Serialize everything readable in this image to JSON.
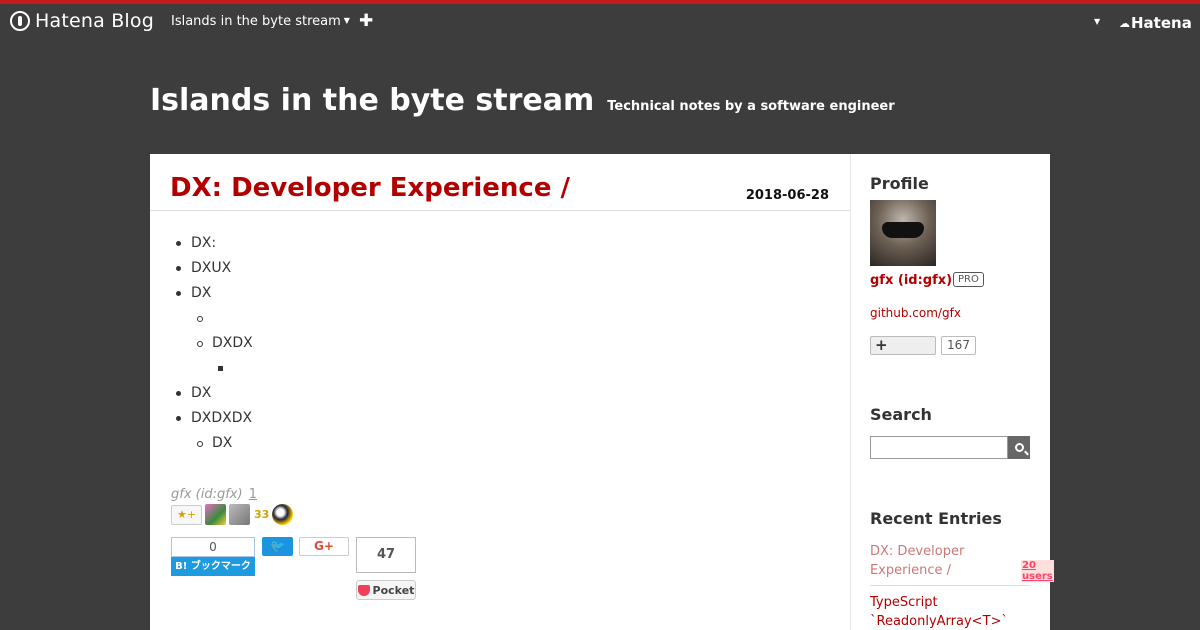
{
  "globalbar": {
    "logo_text": "Hatena Blog",
    "blog_switch": "Islands in the byte stream",
    "plus": "✚",
    "right_caret": "▼",
    "hatena": "Hatena"
  },
  "header": {
    "title": "Islands in the byte stream",
    "description": "Technical notes by a software engineer"
  },
  "entry": {
    "title": "DX: Developer Experience /",
    "date": "2018-06-28",
    "list": [
      {
        "level": 1,
        "text": "DX:"
      },
      {
        "level": 1,
        "text": "DXUX"
      },
      {
        "level": 1,
        "text": "DX"
      },
      {
        "level": 2,
        "text": ""
      },
      {
        "level": 2,
        "text": "DXDX"
      },
      {
        "level": 3,
        "text": ""
      },
      {
        "level": 1,
        "text": "DX"
      },
      {
        "level": 1,
        "text": "DXDXDX"
      },
      {
        "level": 2,
        "text": "DX"
      }
    ],
    "author": "gfx (id:gfx)",
    "comment_count": "1",
    "star_add": "★+",
    "star_count": "33",
    "hatebu_count": "0",
    "hatebu_label": "B! ブックマーク",
    "twitter_label": "🐦",
    "gplus_label": "G+",
    "pocket_count": "47",
    "pocket_label": "Pocket"
  },
  "sidebar": {
    "profile_heading": "Profile",
    "profile_name": "gfx (id:gfx)",
    "pro_badge": "PRO",
    "profile_link": "github.com/gfx",
    "follow_plus": "+",
    "follow_count": "167",
    "search_heading": "Search",
    "search_value": "",
    "recent_heading": "Recent Entries",
    "recent_entries": [
      {
        "title": "DX: Developer Experience /",
        "users": "20 users"
      },
      {
        "title": "TypeScript `ReadonlyArray<T>`"
      }
    ]
  },
  "colors": {
    "accent_red": "#b20000",
    "bar_red": "#c41a1a",
    "background": "#3d3d3d"
  }
}
